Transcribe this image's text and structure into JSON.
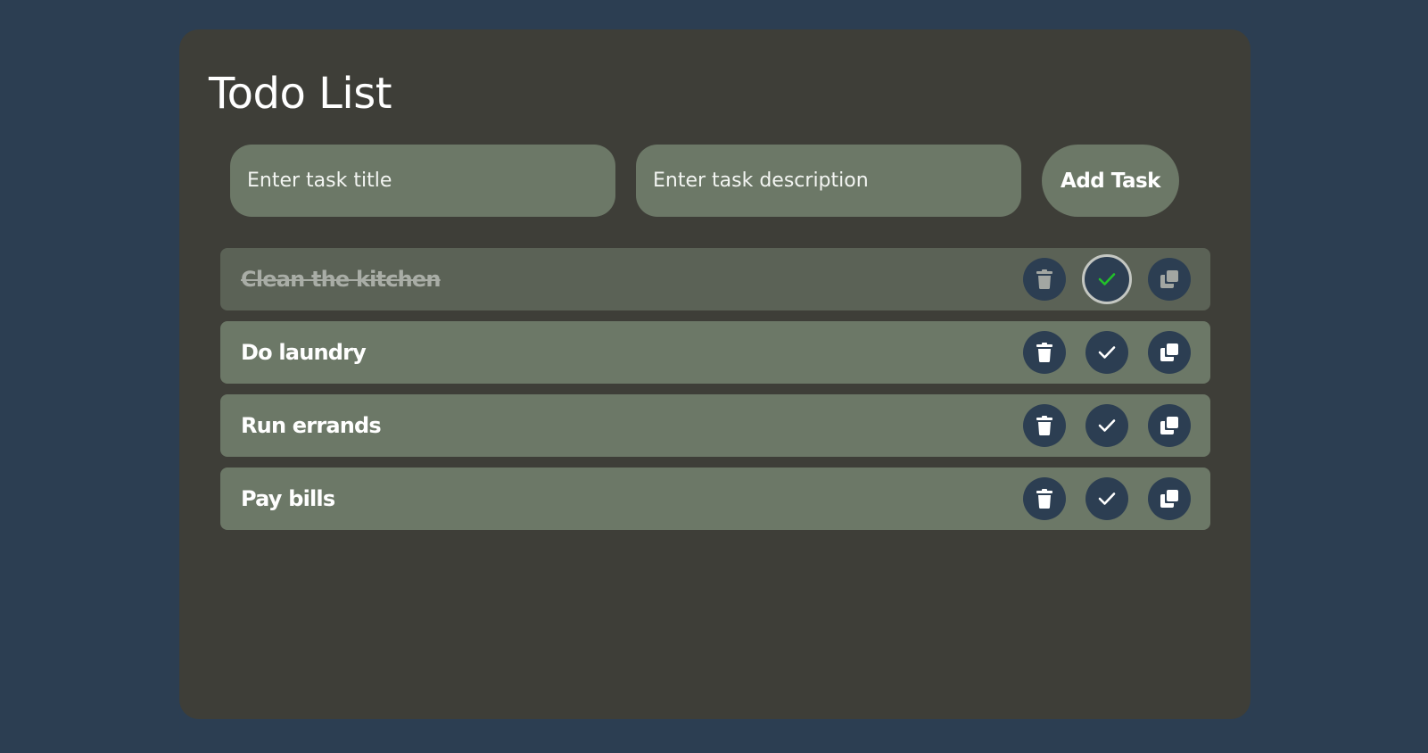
{
  "app": {
    "title": "Todo List"
  },
  "form": {
    "title_placeholder": "Enter task title",
    "title_value": "",
    "description_placeholder": "Enter task description",
    "description_value": "",
    "add_label": "Add Task"
  },
  "tasks": [
    {
      "title": "Clean the kitchen",
      "completed": true
    },
    {
      "title": "Do laundry",
      "completed": false
    },
    {
      "title": "Run errands",
      "completed": false
    },
    {
      "title": "Pay bills",
      "completed": false
    }
  ],
  "icons": {
    "delete": "trash-icon",
    "complete": "check-icon",
    "copy": "copy-icon"
  },
  "colors": {
    "page_background": "#2c3e52",
    "card_background": "#3e3e38",
    "field_background": "#6c7867",
    "completed_row_background": "#5b6256",
    "action_button": "#2c3e52",
    "completed_check": "#22c02a"
  }
}
